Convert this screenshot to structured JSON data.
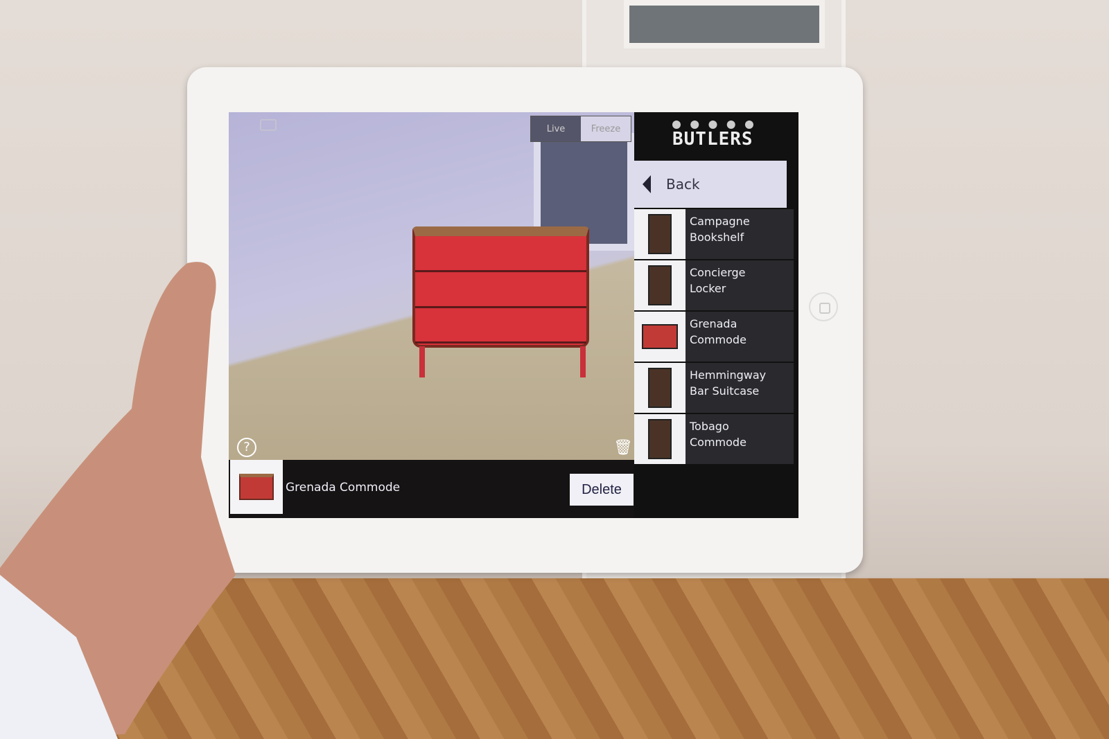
{
  "toolbar": {
    "live_label": "Live",
    "freeze_label": "Freeze"
  },
  "brand": {
    "logo": "BUTLERS"
  },
  "sidebar": {
    "back_label": "Back",
    "items": [
      {
        "line1": "Campagne",
        "line2": "Bookshelf"
      },
      {
        "line1": "Concierge",
        "line2": "Locker"
      },
      {
        "line1": "Grenada",
        "line2": "Commode"
      },
      {
        "line1": "Hemmingway",
        "line2": "Bar Suitcase"
      },
      {
        "line1": "Tobago",
        "line2": "Commode"
      }
    ]
  },
  "bottom": {
    "selected_name": "Grenada  Commode",
    "delete_label": "Delete"
  },
  "icons": {
    "help": "?",
    "trash": "🗑"
  }
}
